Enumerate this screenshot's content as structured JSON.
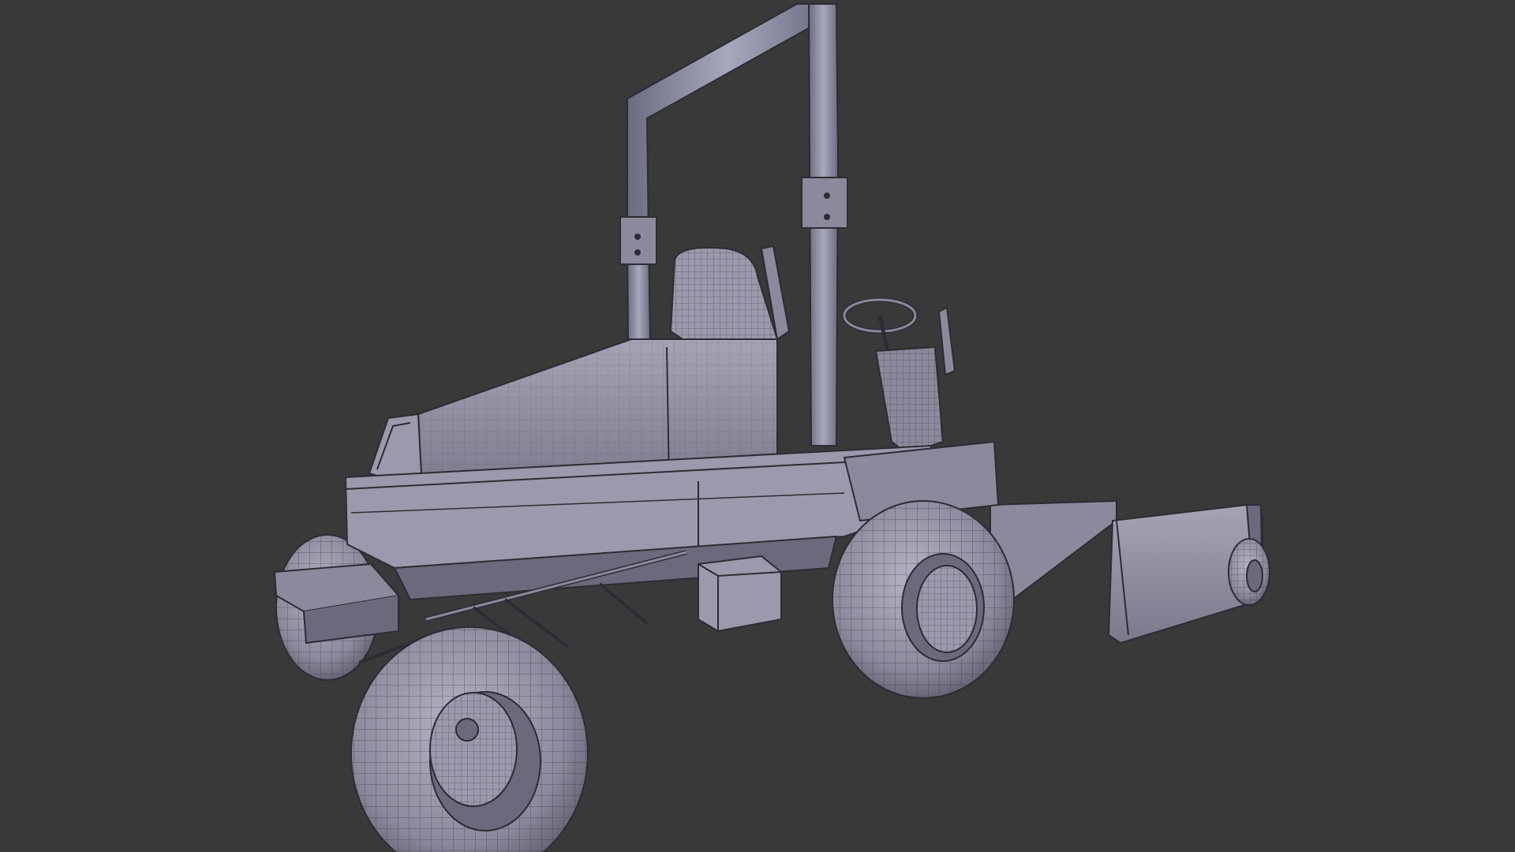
{
  "scene": {
    "subject": "mower-tractor-wireframe",
    "background_color": "#393939",
    "surface_color": "#8e8ea0",
    "surface_light": "#a8a8b8",
    "surface_dark": "#6a6a7c",
    "wire_color": "#2c2c34"
  }
}
